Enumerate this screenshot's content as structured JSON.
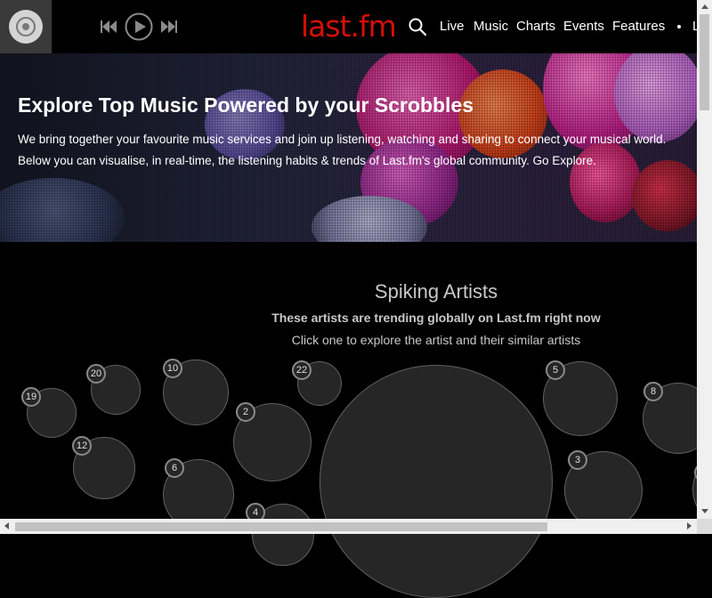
{
  "header": {
    "logo": "last.fm",
    "nav": [
      "Live",
      "Music",
      "Charts",
      "Events",
      "Features"
    ],
    "nav_cut": "L",
    "icons": {
      "player": "vinyl-record-icon",
      "prev": "skip-back-icon",
      "play": "play-icon",
      "next": "skip-forward-icon",
      "search": "search-icon"
    }
  },
  "hero": {
    "title": "Explore Top Music Powered by your Scrobbles",
    "line1": "We bring together your favourite music services and join up listening, watching and sharing to connect your musical world.",
    "line2": "Below you can visualise, in real-time, the listening habits & trends of Last.fm's global community. Go Explore."
  },
  "spiking": {
    "title": "Spiking Artists",
    "subtitle": "These artists are trending globally on Last.fm right now",
    "instruction": "Click one to explore the artist and their similar artists",
    "bubble_labels": [
      "19",
      "20",
      "10",
      "22",
      "5",
      "8",
      "12",
      "2",
      "6",
      "3",
      "4"
    ]
  },
  "colors": {
    "brand": "#d51007",
    "bubble": "#262626",
    "background": "#000000"
  }
}
